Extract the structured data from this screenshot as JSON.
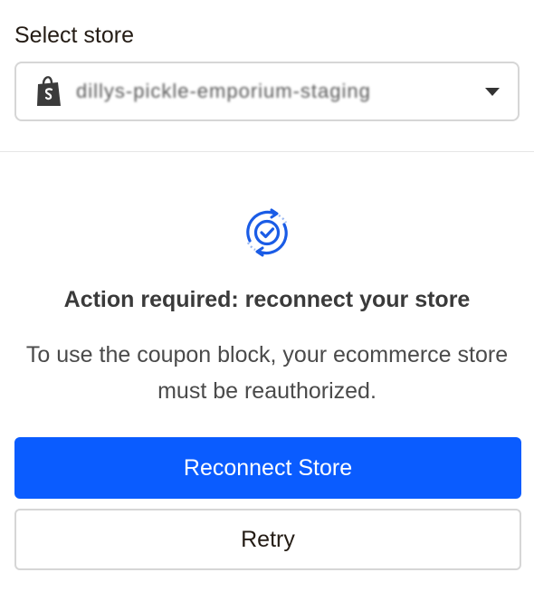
{
  "store_picker": {
    "label": "Select store",
    "selected_store": "dillys-pickle-emporium-staging",
    "platform_icon": "shopify-bag-icon"
  },
  "action": {
    "icon": "sync-check-icon",
    "title": "Action required: reconnect your store",
    "description": "To use the coupon block, your ecommerce store must be reauthorized."
  },
  "buttons": {
    "reconnect_label": "Reconnect Store",
    "retry_label": "Retry"
  },
  "colors": {
    "primary": "#0a5cff",
    "icon_blue": "#1a5ce6",
    "border": "#d6d6d6"
  }
}
